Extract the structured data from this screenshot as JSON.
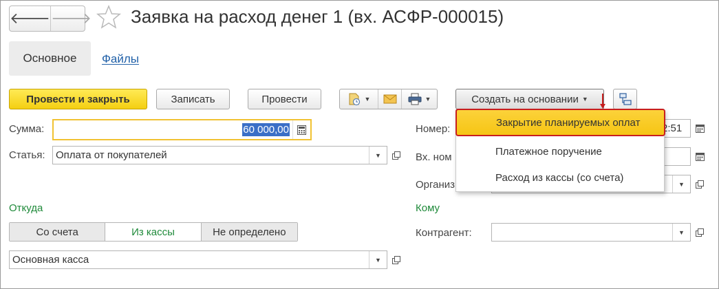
{
  "window": {
    "title": "Заявка на расход денег 1 (вх. АСФР-000015)"
  },
  "nav": {
    "back_icon": "arrow-left-icon",
    "forward_icon": "arrow-right-icon",
    "back_glyph": "🡐",
    "forward_glyph": "🡒",
    "favorite_icon": "star-icon"
  },
  "tabs": [
    {
      "label": "Основное",
      "active": true
    },
    {
      "label": "Файлы",
      "active": false
    }
  ],
  "toolbar": {
    "post_and_close": "Провести и закрыть",
    "save": "Записать",
    "post": "Провести",
    "print_icon": "printer-icon",
    "email_icon": "envelope-icon",
    "report_icon": "document-clock-icon",
    "create_based_on": "Создать на основании",
    "structure_icon": "structure-icon"
  },
  "menu": {
    "items": [
      {
        "label": "Закрытие планируемых оплат",
        "highlighted": true
      },
      {
        "label": "Платежное поручение",
        "highlighted": false
      },
      {
        "label": "Расход из кассы (со счета)",
        "highlighted": false
      }
    ]
  },
  "form": {
    "sum_label": "Сумма:",
    "sum_value": "60 000,00",
    "article_label": "Статья:",
    "article_value": "Оплата от покупателей",
    "number_label": "Номер:",
    "number_value_partial": "2:51",
    "in_number_label": "Вх. ном",
    "org_label": "Организ",
    "from_section": "Откуда",
    "to_section": "Кому",
    "source_options": [
      {
        "label": "Со счета",
        "active": false
      },
      {
        "label": "Из кассы",
        "active": true
      },
      {
        "label": "Не определено",
        "active": false
      }
    ],
    "cashbox_value": "Основная касса",
    "counterparty_label": "Контрагент:",
    "counterparty_value": ""
  },
  "colors": {
    "primary_button": "#f4cf12",
    "section_green": "#1f8a3a",
    "link_blue": "#2060a8",
    "highlight_border": "#c81e1e",
    "selection_blue": "#3a6fc7"
  }
}
